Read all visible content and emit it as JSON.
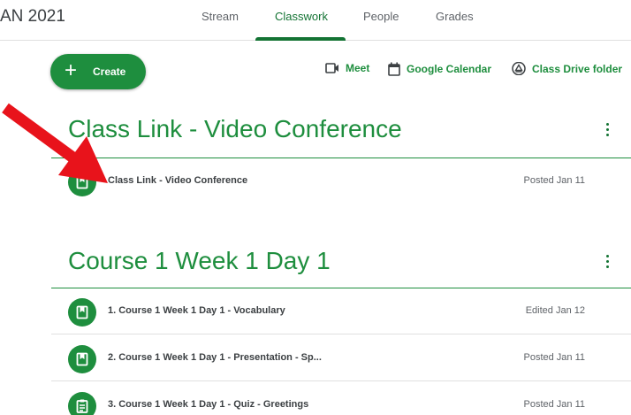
{
  "header": {
    "class_title": "AN 2021",
    "tabs": [
      "Stream",
      "Classwork",
      "People",
      "Grades"
    ]
  },
  "toolbar": {
    "create_label": "Create",
    "meet_label": "Meet",
    "calendar_label": "Google Calendar",
    "drive_label": "Class Drive folder"
  },
  "topics": [
    {
      "title": "Class Link - Video Conference",
      "items": [
        {
          "title": "Class Link - Video Conference",
          "date": "Posted Jan 11",
          "icon": "material-icon"
        }
      ]
    },
    {
      "title": "Course 1 Week 1 Day 1",
      "items": [
        {
          "title": "1. Course 1 Week 1 Day 1 - Vocabulary",
          "date": "Edited Jan 12",
          "icon": "material-icon"
        },
        {
          "title": "2. Course 1 Week 1 Day 1 - Presentation - Sp...",
          "date": "Posted Jan 11",
          "icon": "material-icon"
        },
        {
          "title": "3. Course 1 Week 1 Day 1 - Quiz - Greetings",
          "date": "Posted Jan 11",
          "icon": "quiz-icon"
        }
      ]
    }
  ],
  "colors": {
    "accent": "#1e8e3e",
    "accent_dark": "#137333",
    "annotation_arrow": "#e8131b"
  }
}
